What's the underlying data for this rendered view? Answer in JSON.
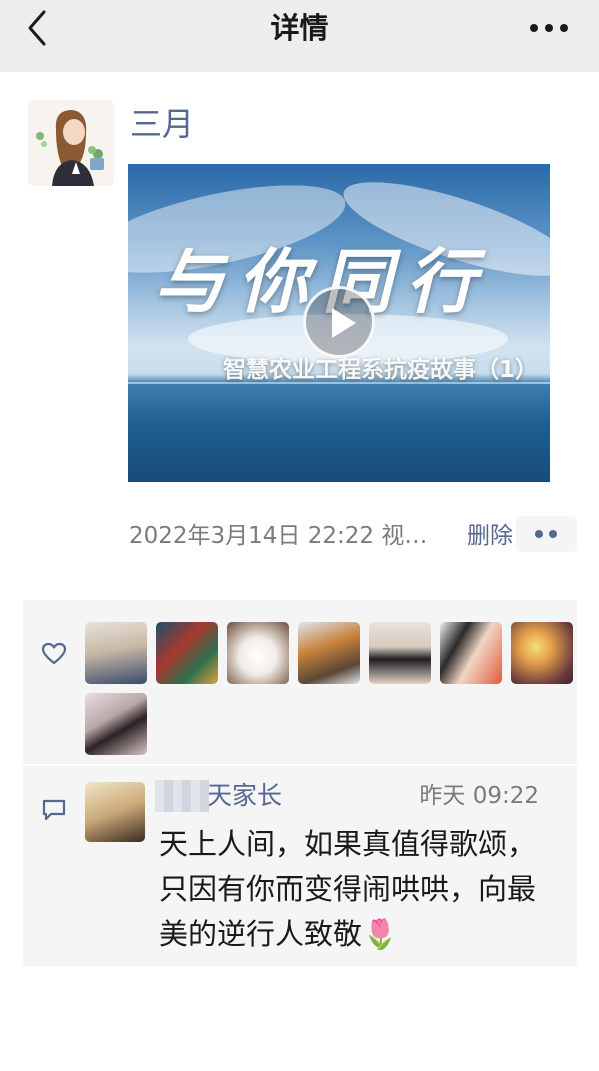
{
  "header": {
    "title": "详情",
    "back_icon": "chevron-left-icon",
    "more_icon": "more-horizontal-icon"
  },
  "post": {
    "author": "三月",
    "video": {
      "title_text": "与你同行",
      "subtitle_text": "智慧农业工程系抗疫故事（1）"
    },
    "timestamp": "2022年3月14日 22:22 视…",
    "delete_label": "删除",
    "actions_icon": "two-dots-icon"
  },
  "likes": {
    "icon": "heart-outline-icon",
    "count_shown": 8
  },
  "comment": {
    "icon": "speech-bubble-icon",
    "author": "天家长",
    "time": "昨天 09:22",
    "text": "天上人间，如果真值得歌颂，只因有你而变得闹哄哄，向最美的逆行人致敬🌷"
  },
  "colors": {
    "header_bg": "#ededed",
    "link_blue": "#55688f",
    "panel_bg": "#f5f5f5",
    "meta_gray": "#7b7b7b"
  }
}
